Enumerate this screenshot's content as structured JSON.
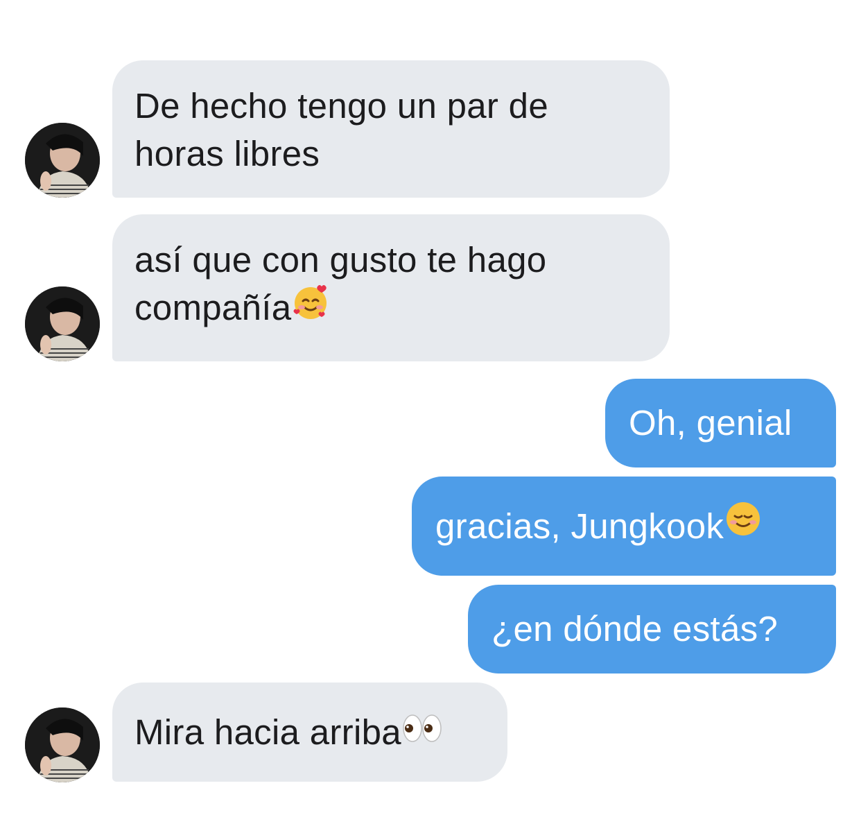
{
  "messages": [
    {
      "side": "in",
      "text": "De hecho tengo un par de horas libres",
      "lines": [
        "De hecho tengo un par de",
        "horas libres"
      ]
    },
    {
      "side": "in",
      "lines": [
        "así que con gusto te hago",
        "compañía"
      ],
      "emoji": "smiling-face-with-hearts"
    },
    {
      "side": "out",
      "text": "Oh, genial"
    },
    {
      "side": "out",
      "text": "gracias, Jungkook",
      "emoji": "smiling-face"
    },
    {
      "side": "out",
      "text": "¿en dónde estás?"
    },
    {
      "side": "in",
      "text": "Mira hacia arriba",
      "emoji": "eyes"
    }
  ],
  "colors": {
    "incoming_bubble": "#e7eaee",
    "outgoing_bubble": "#4e9de8",
    "incoming_text": "#1c1c1e",
    "outgoing_text": "#ffffff"
  }
}
